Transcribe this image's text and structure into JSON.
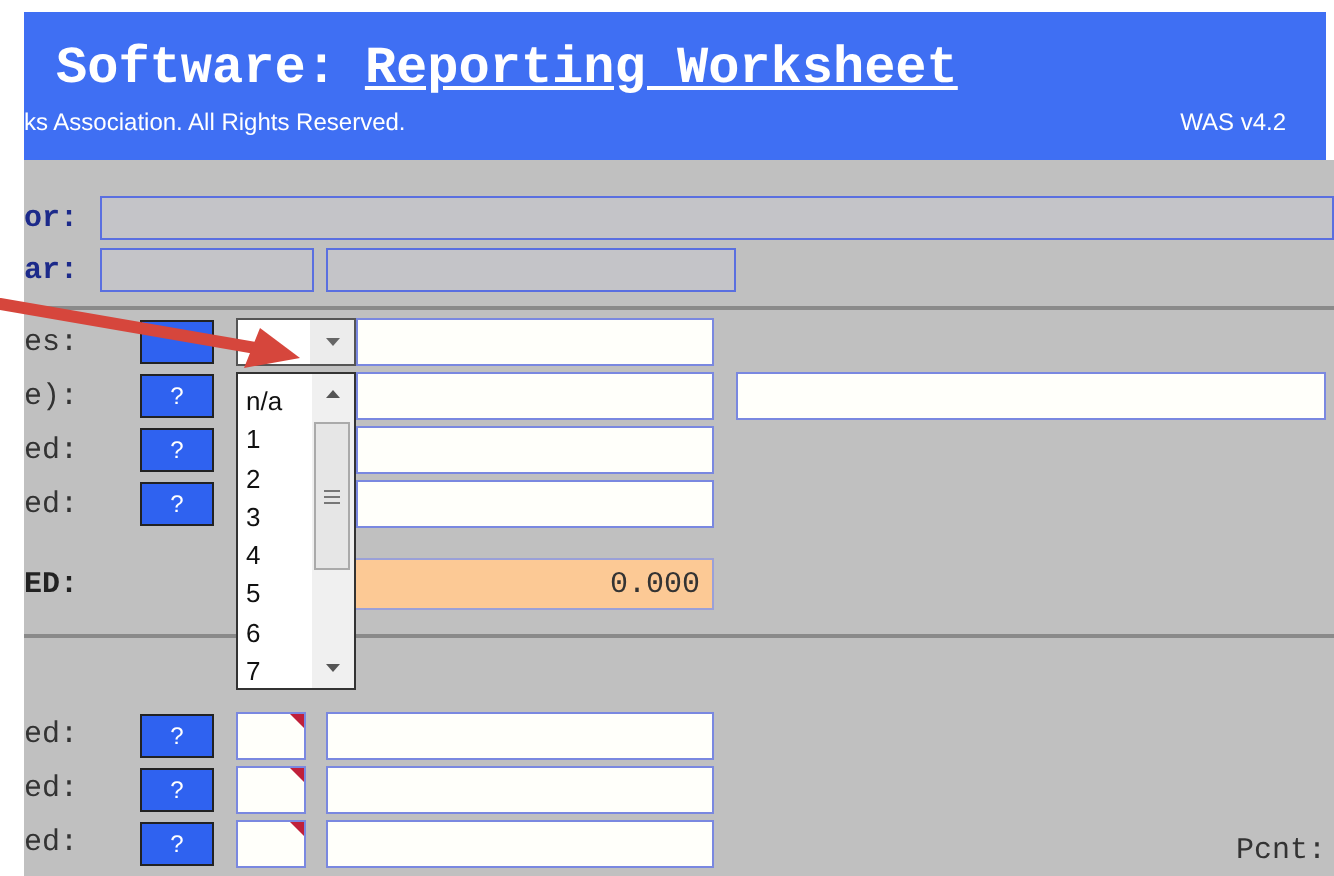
{
  "header": {
    "title_plain": "Software:",
    "title_link": "Reporting Worksheet",
    "copyright": "ks Association. All Rights Reserved.",
    "version": "WAS v4.2"
  },
  "top_rows": [
    {
      "label": "or:",
      "kind": "wide"
    },
    {
      "label": "ar:",
      "kind": "pair"
    }
  ],
  "rows": [
    {
      "label": "es:",
      "kind": "dropdown"
    },
    {
      "label": "e):",
      "help": "?",
      "kind": "extra"
    },
    {
      "label": "ed:",
      "help": "?",
      "kind": "plain"
    },
    {
      "label": "ed:",
      "help": "?",
      "kind": "plain"
    }
  ],
  "total": {
    "label": "ED:",
    "value": "0.000"
  },
  "dropdown_options": [
    "n/a",
    "1",
    "2",
    "3",
    "4",
    "5",
    "6",
    "7"
  ],
  "lower_rows": [
    {
      "label": "ed:",
      "help": "?"
    },
    {
      "label": "ed:",
      "help": "?"
    },
    {
      "label": "ed:",
      "help": "?"
    }
  ],
  "pcnt_label": "Pcnt:"
}
